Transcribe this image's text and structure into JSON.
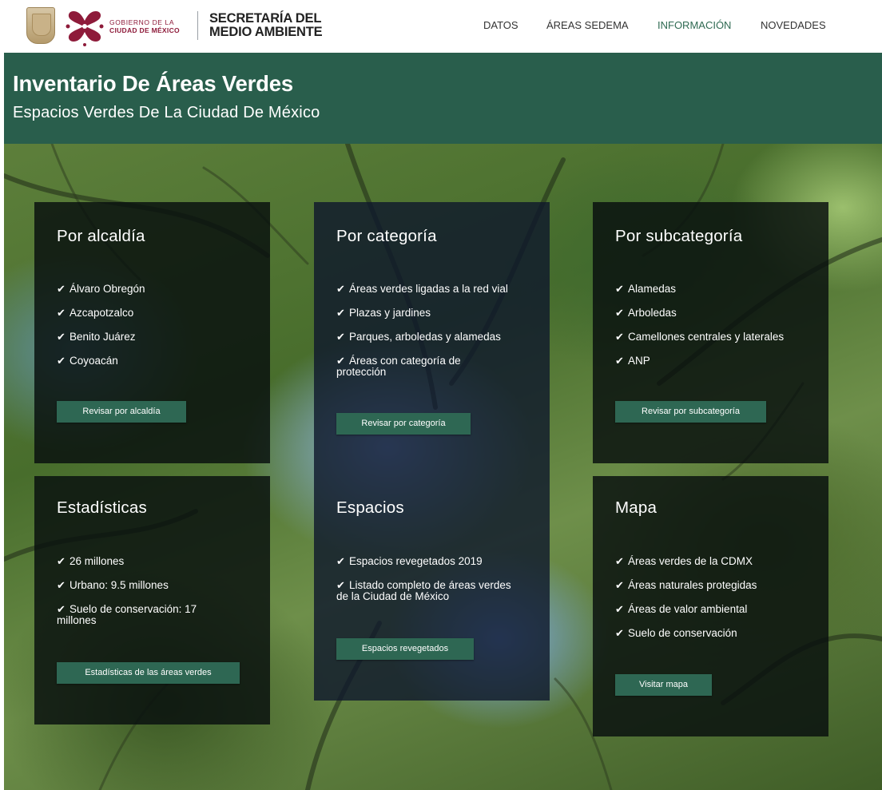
{
  "header": {
    "gov_line1": "GOBIERNO DE LA",
    "gov_line2": "CIUDAD DE MÉXICO",
    "secretaria_line1": "SECRETARÍA DEL",
    "secretaria_line2": "MEDIO AMBIENTE",
    "nav": [
      {
        "label": "DATOS"
      },
      {
        "label": "ÁREAS SEDEMA"
      },
      {
        "label": "INFORMACIÓN",
        "active": true
      },
      {
        "label": "NOVEDADES"
      }
    ]
  },
  "banner": {
    "title": "Inventario De Áreas Verdes",
    "subtitle": "Espacios Verdes De La Ciudad De México"
  },
  "cards": [
    {
      "title": "Por alcaldía",
      "items": [
        "Álvaro Obregón",
        "Azcapotzalco",
        "Benito Juárez",
        "Coyoacán"
      ],
      "button": "Revisar por alcaldía"
    },
    {
      "title": "Por categoría",
      "items": [
        "Áreas verdes ligadas a la red vial",
        "Plazas y jardines",
        "Parques, arboledas y alamedas",
        "Áreas con categoría de protección"
      ],
      "button": "Revisar por categoría"
    },
    {
      "title": "Por subcategoría",
      "items": [
        "Alamedas",
        "Arboledas",
        "Camellones centrales y laterales",
        "ANP"
      ],
      "button": "Revisar por subcategoría"
    },
    {
      "title": "Estadísticas",
      "items": [
        "26 millones",
        "Urbano: 9.5 millones",
        "Suelo de conservación: 17 millones"
      ],
      "button": "Estadísticas de las áreas verdes"
    },
    {
      "title": "Espacios",
      "items": [
        "Espacios revegetados 2019",
        "Listado completo de áreas verdes de la Ciudad de México"
      ],
      "button": "Espacios revegetados"
    },
    {
      "title": "Mapa",
      "items": [
        "Áreas verdes de la CDMX",
        "Áreas naturales protegidas",
        "Áreas de valor ambiental",
        "Suelo de conservación"
      ],
      "button": "Visitar mapa"
    }
  ],
  "icons": {
    "list_marker": "checkmark-icon"
  },
  "colors": {
    "brand_green": "#295e4c",
    "button_green": "#2e6753",
    "gov_accent": "#8e1b3a"
  }
}
